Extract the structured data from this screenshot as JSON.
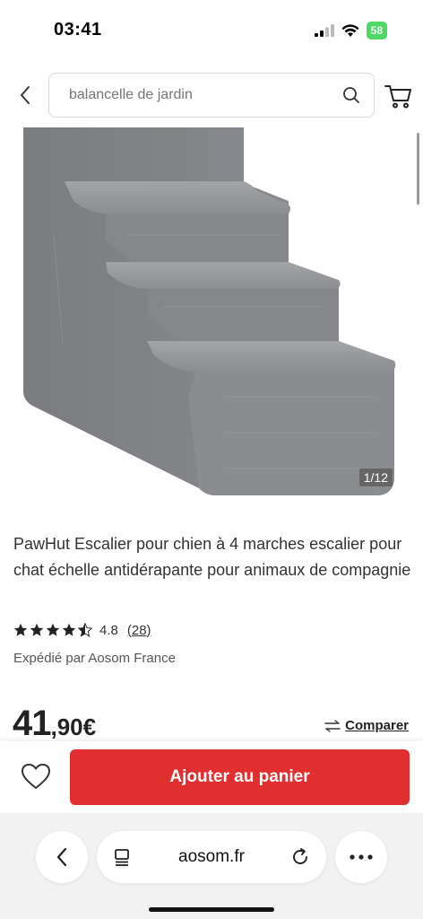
{
  "status": {
    "time": "03:41",
    "battery": "58"
  },
  "search": {
    "placeholder": "balancelle de jardin"
  },
  "product": {
    "image_counter": "1/12",
    "title": "PawHut Escalier pour chien à 4 marches escalier pour chat échelle antidérapante pour animaux de compagnie",
    "rating_value": "4.8",
    "rating_count": "(28)",
    "rating_stars": 4.5,
    "shipped_by": "Expédié par Aosom France",
    "price_int": "41",
    "price_dec": ",90€",
    "compare_label": "Comparer"
  },
  "actions": {
    "add_to_cart": "Ajouter au panier"
  },
  "browser": {
    "url": "aosom.fr"
  },
  "colors": {
    "accent": "#e12f2f",
    "battery": "#4cd964"
  }
}
